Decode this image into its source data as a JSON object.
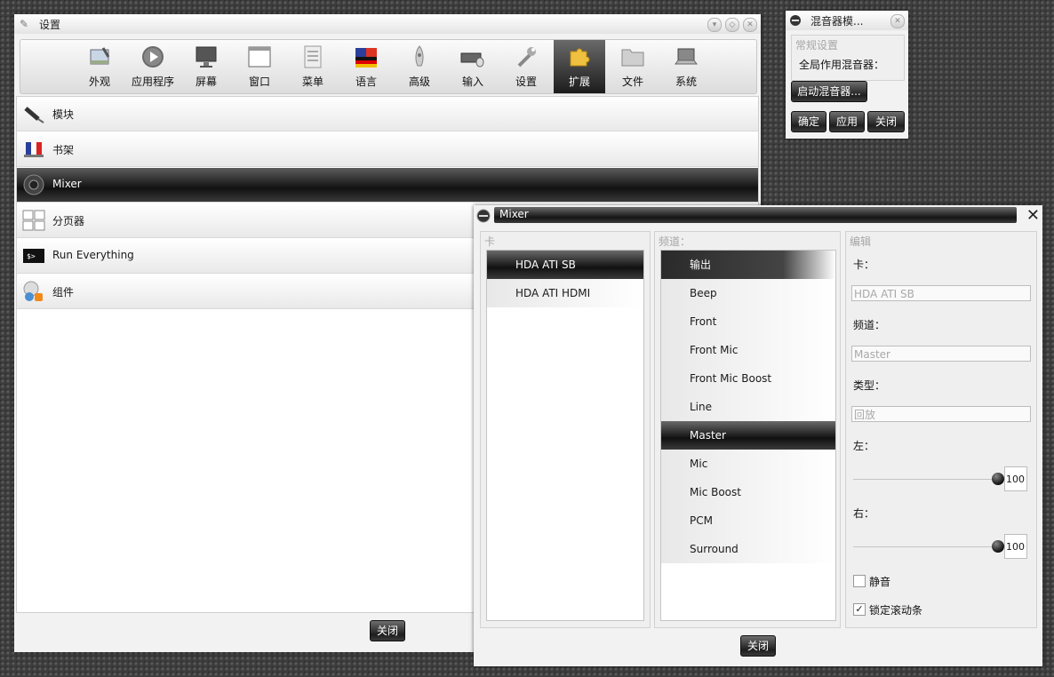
{
  "settings_window": {
    "title": "设置",
    "toolbar": [
      {
        "label": "外观",
        "icon": "appearance-icon"
      },
      {
        "label": "应用程序",
        "icon": "play-icon"
      },
      {
        "label": "屏幕",
        "icon": "monitor-icon"
      },
      {
        "label": "窗口",
        "icon": "window-icon"
      },
      {
        "label": "菜单",
        "icon": "menu-icon"
      },
      {
        "label": "语言",
        "icon": "flag-icon"
      },
      {
        "label": "高级",
        "icon": "rocket-icon"
      },
      {
        "label": "输入",
        "icon": "keyboard-mouse-icon"
      },
      {
        "label": "设置",
        "icon": "wrench-icon"
      },
      {
        "label": "扩展",
        "icon": "puzzle-icon"
      },
      {
        "label": "文件",
        "icon": "folder-icon"
      },
      {
        "label": "系统",
        "icon": "laptop-icon"
      }
    ],
    "active_tool": "扩展",
    "modules": [
      {
        "label": "模块",
        "icon": "plug-icon"
      },
      {
        "label": "书架",
        "icon": "bookshelf-flag-icon"
      },
      {
        "label": "Mixer",
        "icon": "speaker-icon",
        "selected": true
      },
      {
        "label": "分页器",
        "icon": "pager-grid-icon"
      },
      {
        "label": "Run Everything",
        "icon": "terminal-icon"
      },
      {
        "label": "组件",
        "icon": "gadgets-icon"
      }
    ],
    "close_label": "关闭"
  },
  "mixer_module_window": {
    "title": "混音器模...",
    "section": "常规设置",
    "global_label": "全局作用混音器：",
    "launch_label": "启动混音器...",
    "ok_label": "确定",
    "apply_label": "应用",
    "close_label": "关闭"
  },
  "mixer_window": {
    "title": "Mixer",
    "cards_title": "卡",
    "cards": [
      {
        "label": "HDA ATI SB",
        "selected": true
      },
      {
        "label": "HDA ATI HDMI",
        "selected": false
      }
    ],
    "channels_title": "频道：",
    "channels": [
      {
        "label": "输出",
        "header": true
      },
      {
        "label": "Beep"
      },
      {
        "label": "Front"
      },
      {
        "label": "Front Mic"
      },
      {
        "label": "Front Mic Boost"
      },
      {
        "label": "Line"
      },
      {
        "label": "Master",
        "selected": true
      },
      {
        "label": "Mic"
      },
      {
        "label": "Mic Boost"
      },
      {
        "label": "PCM"
      },
      {
        "label": "Surround"
      }
    ],
    "edit_title": "编辑",
    "card_label": "卡：",
    "card_value": "HDA ATI SB",
    "channel_label": "频道：",
    "channel_value": "Master",
    "type_label": "类型：",
    "type_value": "回放",
    "left_label": "左：",
    "left_value": "100",
    "right_label": "右：",
    "right_value": "100",
    "mute_label": "静音",
    "mute_checked": false,
    "lock_label": "锁定滚动条",
    "lock_checked": true,
    "check_mark": "✓",
    "close_label": "关闭"
  }
}
